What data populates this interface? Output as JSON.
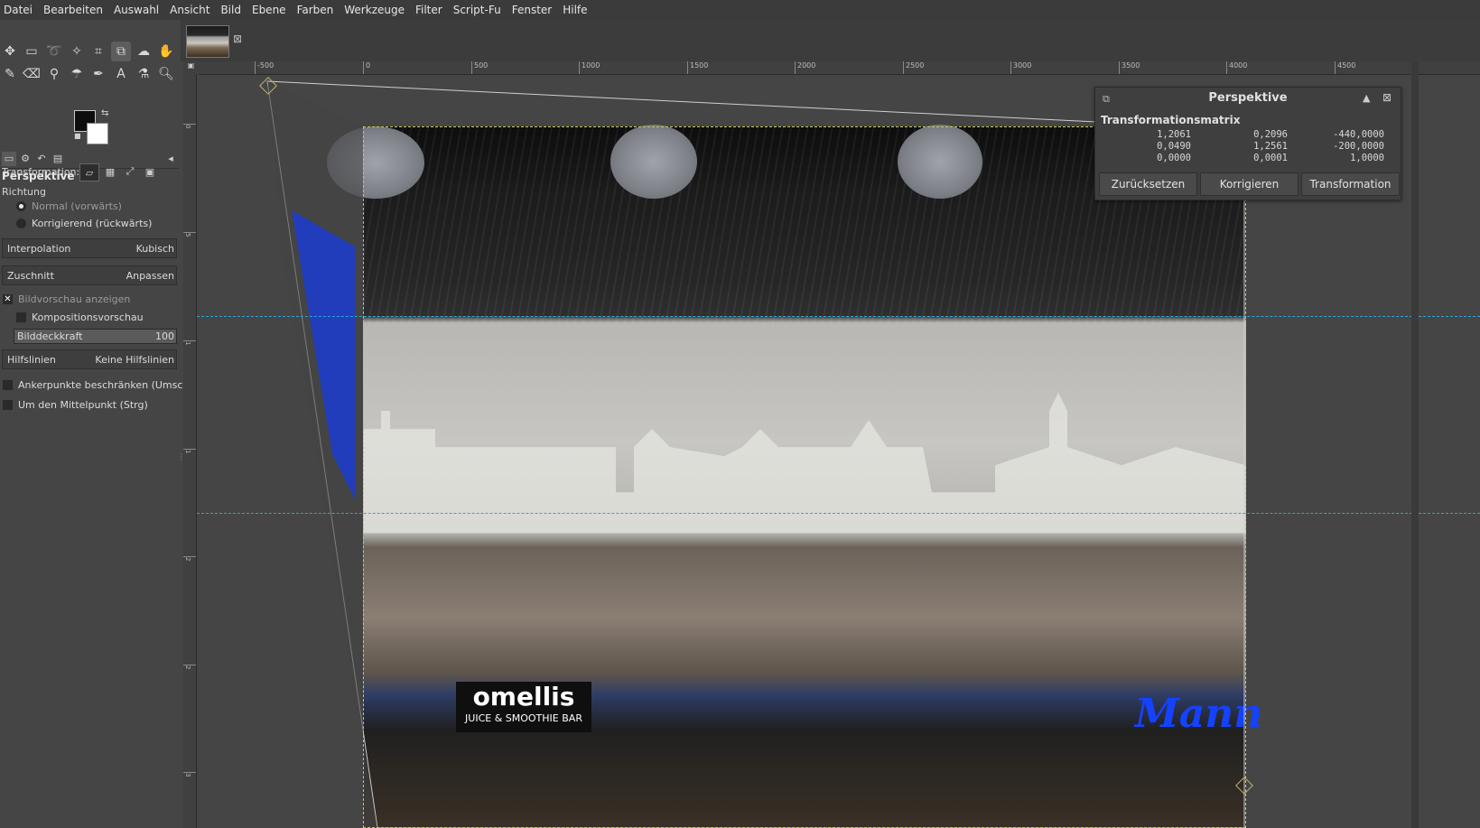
{
  "menu": [
    "Datei",
    "Bearbeiten",
    "Auswahl",
    "Ansicht",
    "Bild",
    "Ebene",
    "Farben",
    "Werkzeuge",
    "Filter",
    "Script-Fu",
    "Fenster",
    "Hilfe"
  ],
  "tool_options": {
    "title": "Perspektive",
    "transformation_label": "Transformation:",
    "richtung_label": "Richtung",
    "richtung_normal": "Normal (vorwärts)",
    "richtung_korrigierend": "Korrigierend (rückwärts)",
    "interpolation_label": "Interpolation",
    "interpolation_value": "Kubisch",
    "zuschnitt_label": "Zuschnitt",
    "zuschnitt_value": "Anpassen",
    "bildvorschau": "Bildvorschau anzeigen",
    "kompositionsvorschau": "Kompositionsvorschau",
    "bilddeckkraft_label": "Bilddeckkraft",
    "bilddeckkraft_value": "100",
    "bilddeckkraft_level": 1.0,
    "hilfslinien_label": "Hilfslinien",
    "hilfslinien_value": "Keine Hilfslinien",
    "ankerpunkte": "Ankerpunkte beschränken (Umsc",
    "mittelpunkt": "Um den Mittelpunkt (Strg)"
  },
  "ruler_h": [
    "-500",
    "0",
    "500",
    "1000",
    "1500",
    "2000",
    "2500",
    "3000",
    "3500",
    "4000",
    "4500"
  ],
  "ruler_v": [
    "0",
    "5",
    "1",
    "1",
    "2",
    "2",
    "3"
  ],
  "image": {
    "sign_brand": "omellis",
    "sign_sub": "JUICE & SMOOTHIE BAR",
    "shop_right": "Mann"
  },
  "dialog": {
    "title": "Perspektive",
    "subtitle": "Transformationsmatrix",
    "matrix": [
      [
        "1,2061",
        "0,2096",
        "-440,0000"
      ],
      [
        "0,0490",
        "1,2561",
        "-200,0000"
      ],
      [
        "0,0000",
        "0,0001",
        "1,0000"
      ]
    ],
    "buttons": [
      "Zurücksetzen",
      "Korrigieren",
      "Transformation"
    ]
  },
  "colors": {
    "accent_guide": "#2aa6d8",
    "brand_blue": "#1442ff",
    "panel_bg": "#454545"
  }
}
